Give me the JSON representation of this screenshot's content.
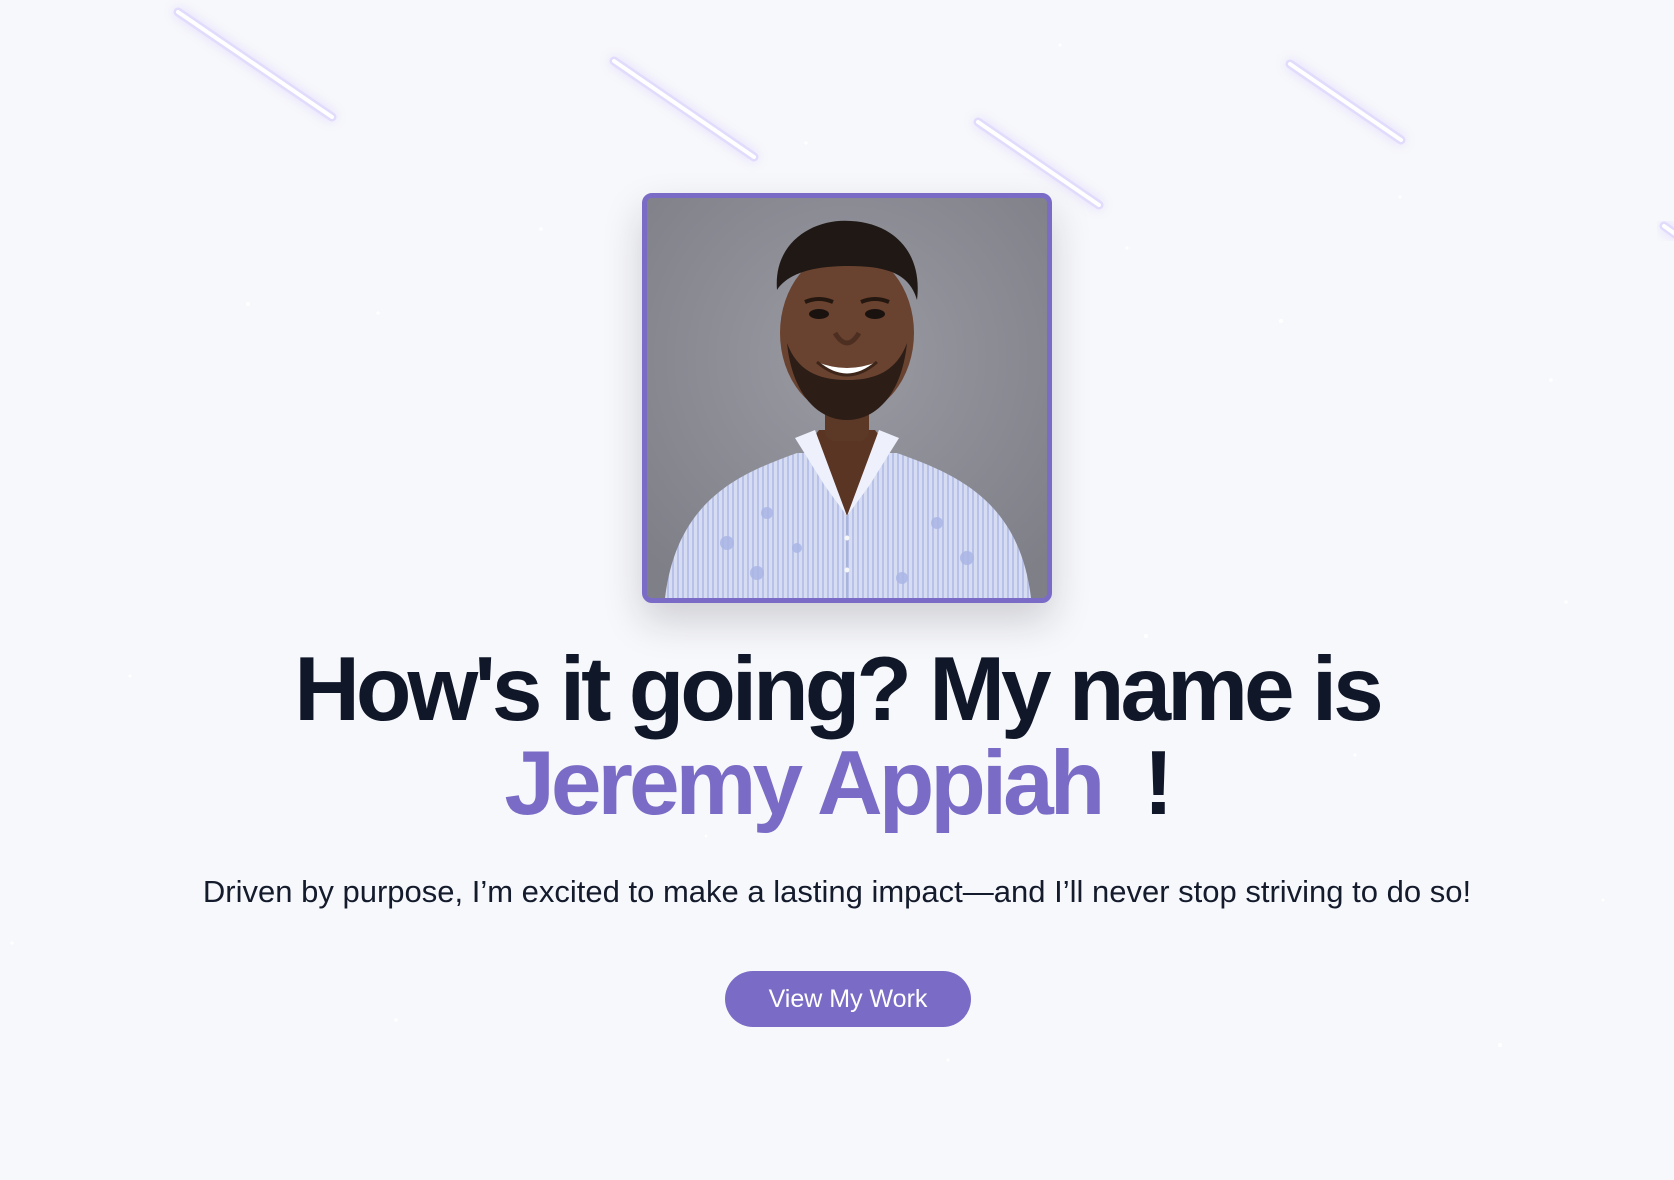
{
  "hero": {
    "portrait_alt": "Portrait of Jeremy Appiah",
    "greeting": "How's it going? My name is",
    "name": "Jeremy Appiah",
    "exclamation": "!",
    "subtitle": "Driven by purpose, I’m excited to make a lasting impact—and I’ll never stop striving to do so!",
    "cta_label": "View My Work"
  },
  "colors": {
    "background": "#f7f8fb",
    "accent": "#7a6cc6",
    "heading": "#101729",
    "glow": "#b9a4ff"
  }
}
